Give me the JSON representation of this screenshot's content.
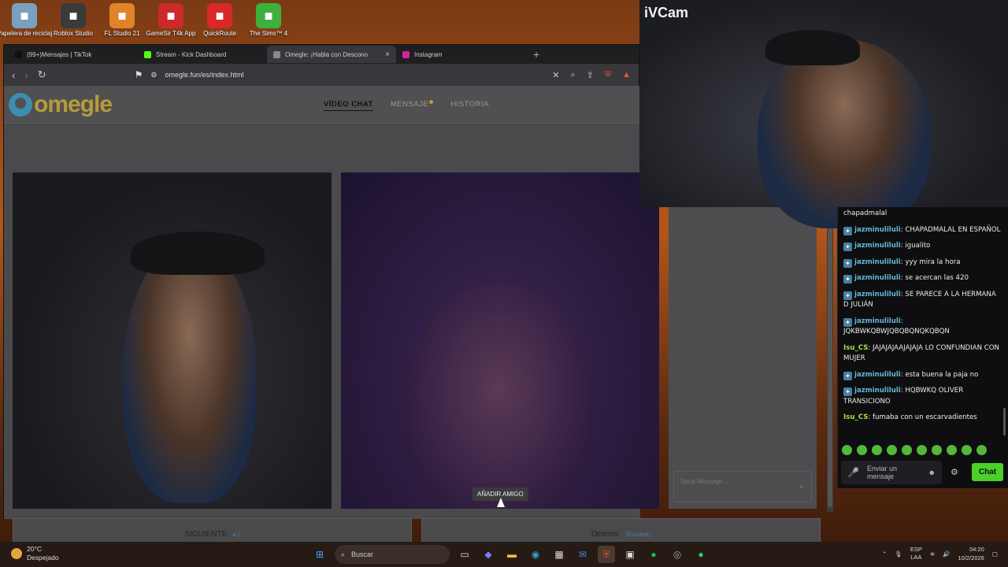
{
  "desktop": {
    "icons": [
      {
        "label": "Papelera de reciclaje",
        "icon": "recycle-bin-icon",
        "color": "#7aa0c0"
      },
      {
        "label": "Roblox Studio",
        "icon": "roblox-icon",
        "color": "#3a3a3a"
      },
      {
        "label": "FL Studio 21",
        "icon": "fl-studio-icon",
        "color": "#e0832a"
      },
      {
        "label": "GameSir T4k App",
        "icon": "gamesir-icon",
        "color": "#cc2a2a"
      },
      {
        "label": "QuickRoute",
        "icon": "quickroute-icon",
        "color": "#d82828"
      },
      {
        "label": "The Sims™ 4",
        "icon": "sims-icon",
        "color": "#3db03d"
      }
    ]
  },
  "browser": {
    "tabs": [
      {
        "label": "(99+)Mensajes | TikTok",
        "icon": "tiktok-icon",
        "color": "#111111",
        "active": false
      },
      {
        "label": "Stream - Kick Dashboard",
        "icon": "kick-icon",
        "color": "#53fc18",
        "active": false
      },
      {
        "label": "Omegle: ¡Habla con Descono",
        "icon": "omegle-icon",
        "color": "#888888",
        "active": true
      },
      {
        "label": "Instagram",
        "icon": "instagram-icon",
        "color": "#d6249f",
        "active": false
      }
    ],
    "new_tab": "+",
    "url": "omegle.fun/es/index.html"
  },
  "omegle": {
    "logo": "omegle",
    "nav": [
      "VÍDEO CHAT",
      "MENSAJE",
      "HISTORIA"
    ],
    "add_friend": "AÑADIR AMIGO",
    "send_placeholder": "Send Message...",
    "next_label": "SIGUIENTE",
    "next_hint": "▸ |",
    "stop_label": "Detener",
    "stop_hint": "(Escape)"
  },
  "ivcam": {
    "title": "iVCam"
  },
  "chat": {
    "messages": [
      {
        "user": "",
        "text": "chapadmalal",
        "badge": false,
        "color": "u1"
      },
      {
        "user": "jazminuliluli",
        "text": ": CHAPADMALAL EN ESPAÑOL",
        "badge": true,
        "color": "u1"
      },
      {
        "user": "jazminuliluli",
        "text": ": igualito",
        "badge": true,
        "color": "u1"
      },
      {
        "user": "jazminuliluli",
        "text": ": yyy mira la hora",
        "badge": true,
        "color": "u1"
      },
      {
        "user": "jazminuliluli",
        "text": ": se acercan las 420",
        "badge": true,
        "color": "u1"
      },
      {
        "user": "jazminuliluli",
        "text": ": SE PARECE A LA HERMANA D JULIÁN",
        "badge": true,
        "color": "u1"
      },
      {
        "user": "jazminuliluli",
        "text": ": JQKBWKQBWJQBQBQNQKQBQN",
        "badge": true,
        "color": "u1"
      },
      {
        "user": "Isu_CS",
        "text": ": JAJAJAJAAJAJAJA LO CONFUNDIAN CON MUJER",
        "badge": false,
        "color": "u2"
      },
      {
        "user": "jazminuliluli",
        "text": ": esta buena la paja no",
        "badge": true,
        "color": "u1"
      },
      {
        "user": "jazminuliluli",
        "text": ": HQBWKQ OLIVER TRANSICIONO",
        "badge": true,
        "color": "u1"
      },
      {
        "user": "Isu_CS",
        "text": ": fumaba con un escarvadientes",
        "badge": false,
        "color": "u2"
      }
    ],
    "input_placeholder": "Enviar un mensaje",
    "send_button": "Chat"
  },
  "taskbar": {
    "temp": "20°C",
    "weather": "Despejado",
    "search": "Buscar",
    "lang_top": "ESP",
    "lang_bottom": "LAA",
    "time": "04:20",
    "date": "10/2/2026"
  }
}
